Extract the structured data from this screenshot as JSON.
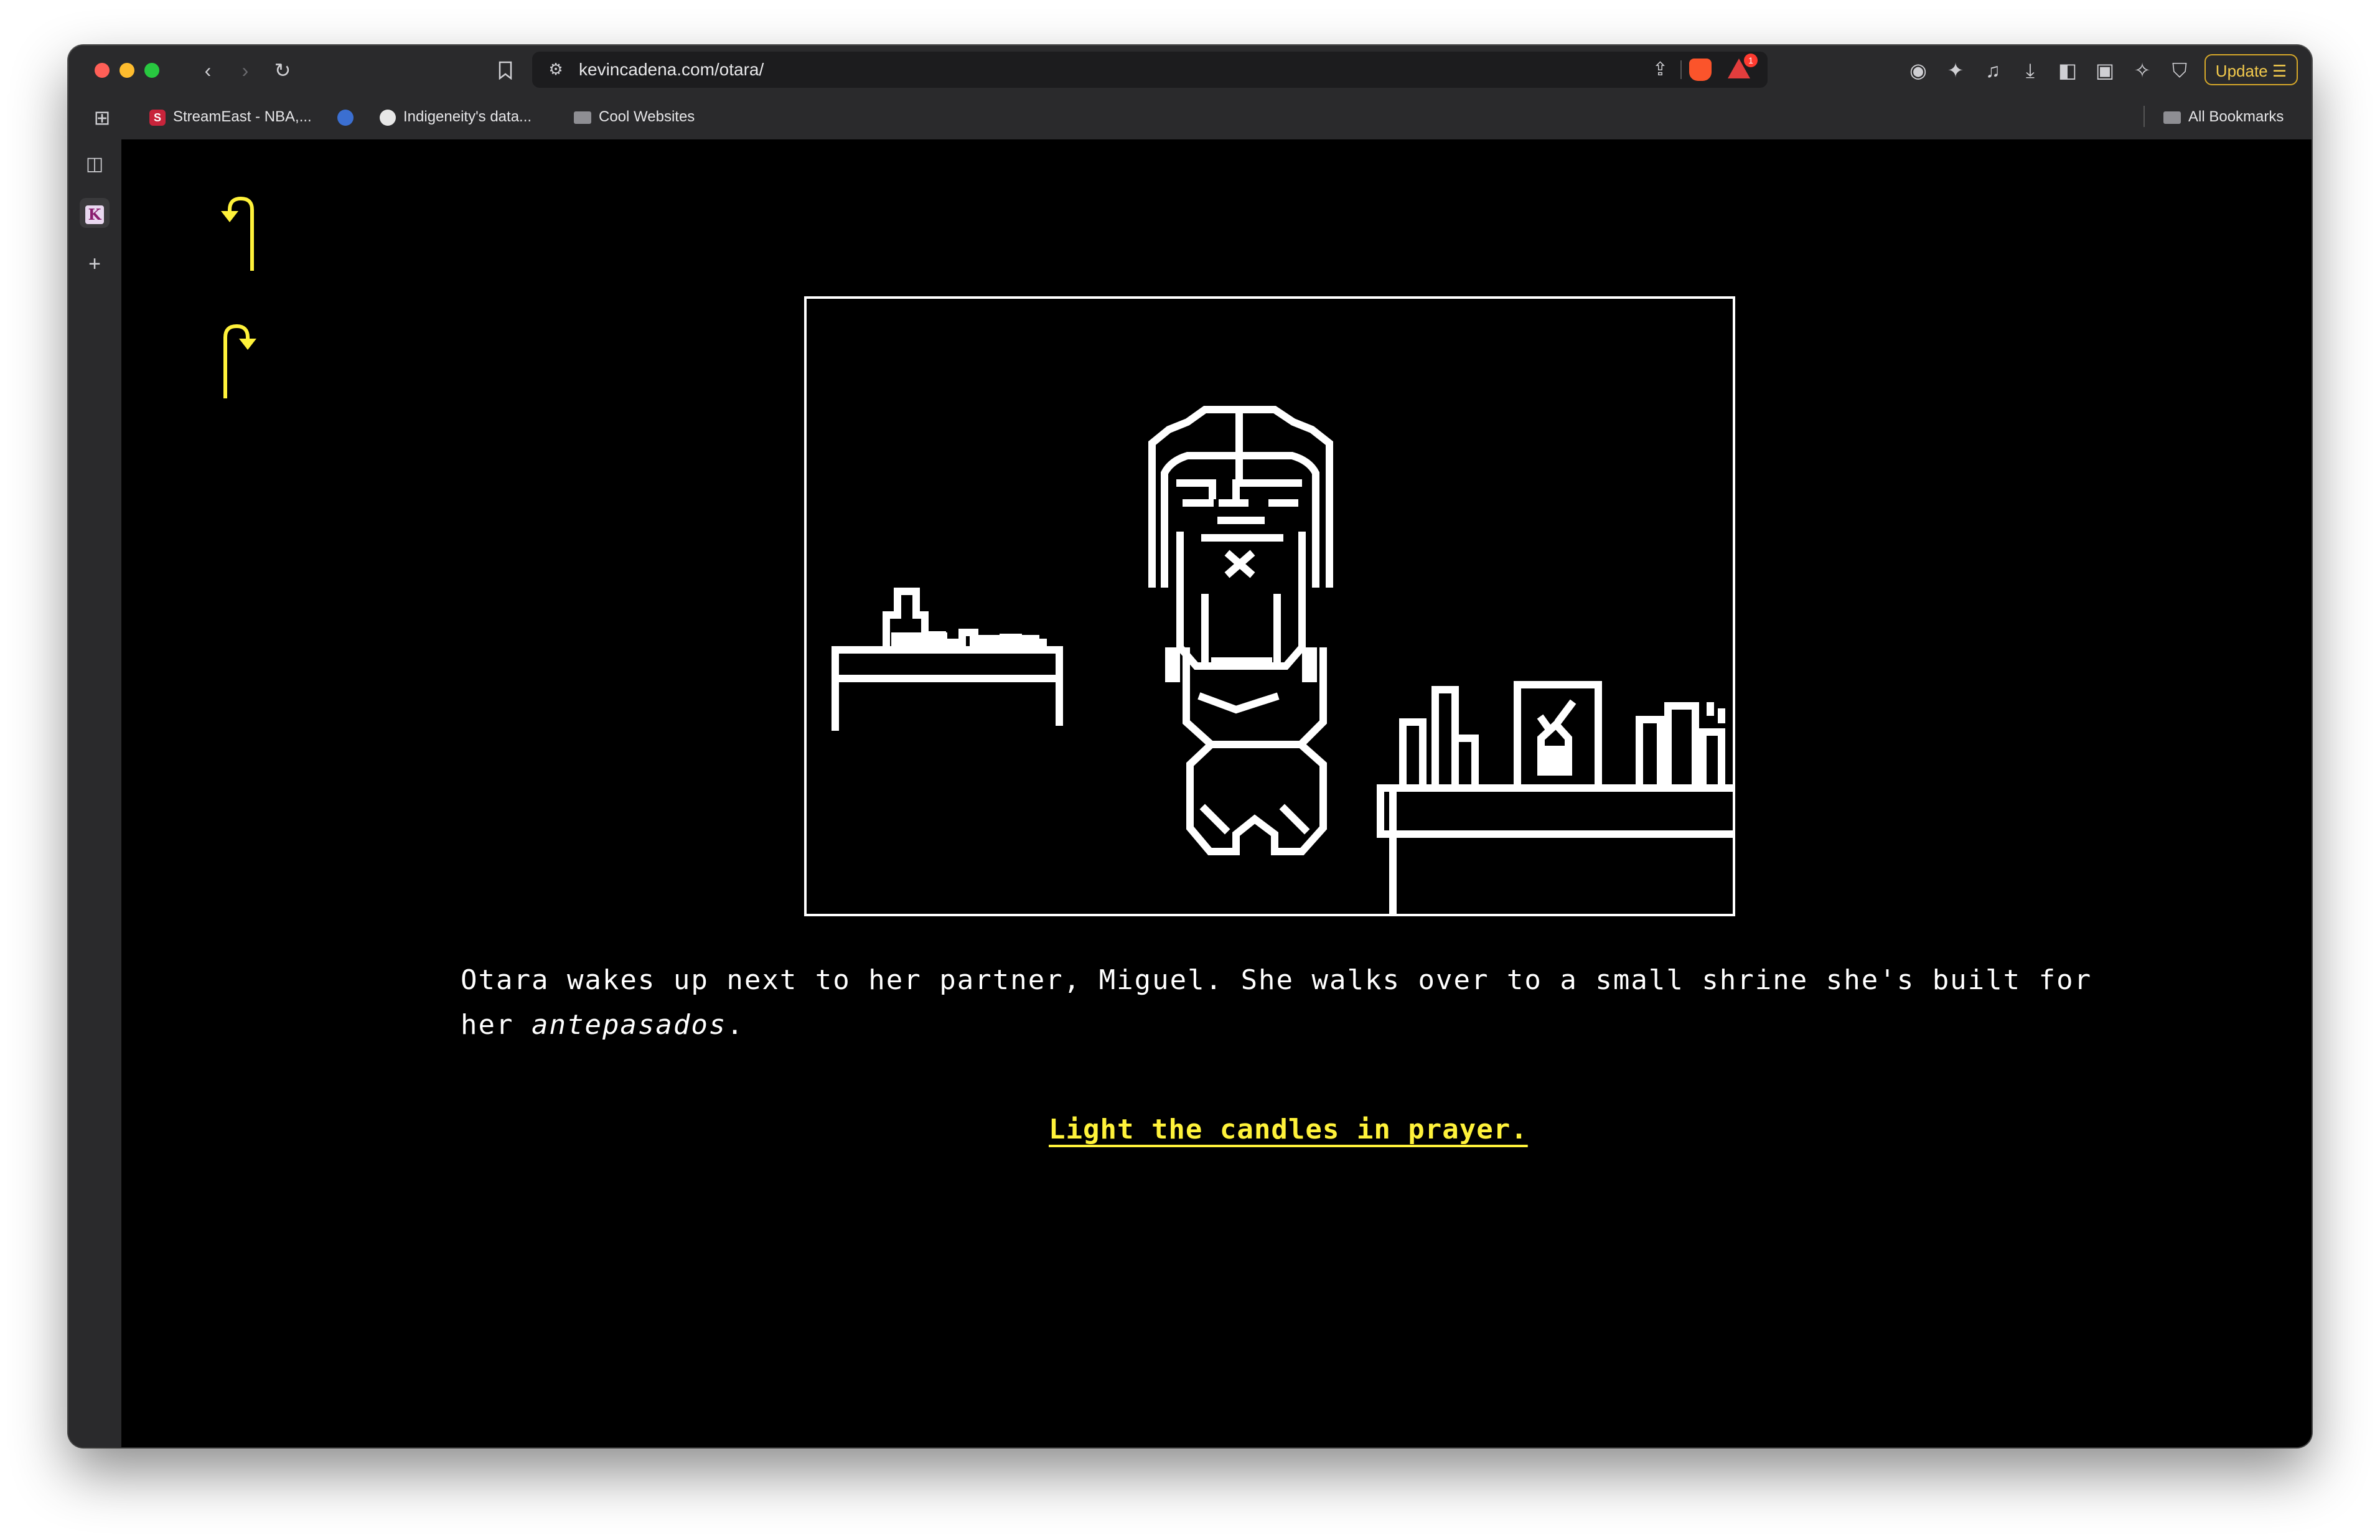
{
  "browser": {
    "url": "kevincadena.com/otara/",
    "update_label": "Update",
    "alert_count": "1"
  },
  "bookmarks": {
    "items": [
      {
        "label": "StreamEast - NBA,..."
      },
      {
        "label": "Indigeneity's data..."
      },
      {
        "label": "Cool Websites"
      }
    ],
    "all_bookmarks": "All Bookmarks"
  },
  "sidebar": {
    "active_tab_letter": "K",
    "add_label": "+"
  },
  "story": {
    "text": "Otara wakes up next to her partner, Miguel. She walks over to a small shrine she's built for her",
    "emphasis": "antepasados",
    "end": ".",
    "choice": "Light the candles in prayer."
  },
  "colors": {
    "accent": "#fff23a",
    "background": "#000000",
    "text": "#ffffff"
  }
}
